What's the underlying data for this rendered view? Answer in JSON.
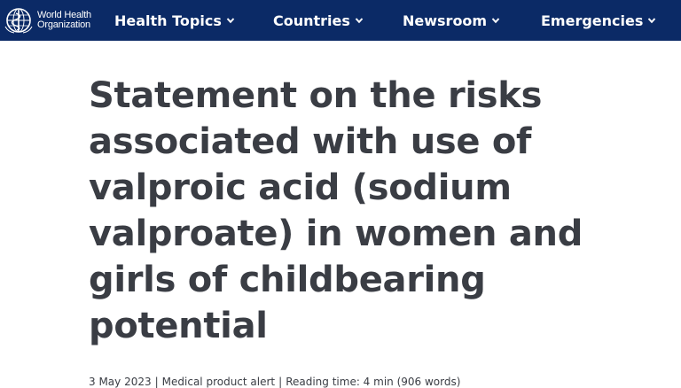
{
  "header": {
    "logo": {
      "line1": "World Health",
      "line2": "Organization",
      "icon": "who-emblem-icon"
    },
    "nav": [
      {
        "label": "Health Topics",
        "icon": "chevron-down-icon"
      },
      {
        "label": "Countries",
        "icon": "chevron-down-icon"
      },
      {
        "label": "Newsroom",
        "icon": "chevron-down-icon"
      },
      {
        "label": "Emergencies",
        "icon": "chevron-down-icon"
      }
    ]
  },
  "article": {
    "title": "Statement on the risks associated with use of valproic acid (sodium valproate) in women and girls of childbearing potential",
    "meta": {
      "date": "3 May 2023",
      "type": "Medical product alert",
      "reading_time": "Reading time: 4 min (906 words)"
    }
  },
  "colors": {
    "nav_background": "#0b2a66",
    "nav_text": "#ffffff",
    "title_text": "#3a3d44"
  }
}
